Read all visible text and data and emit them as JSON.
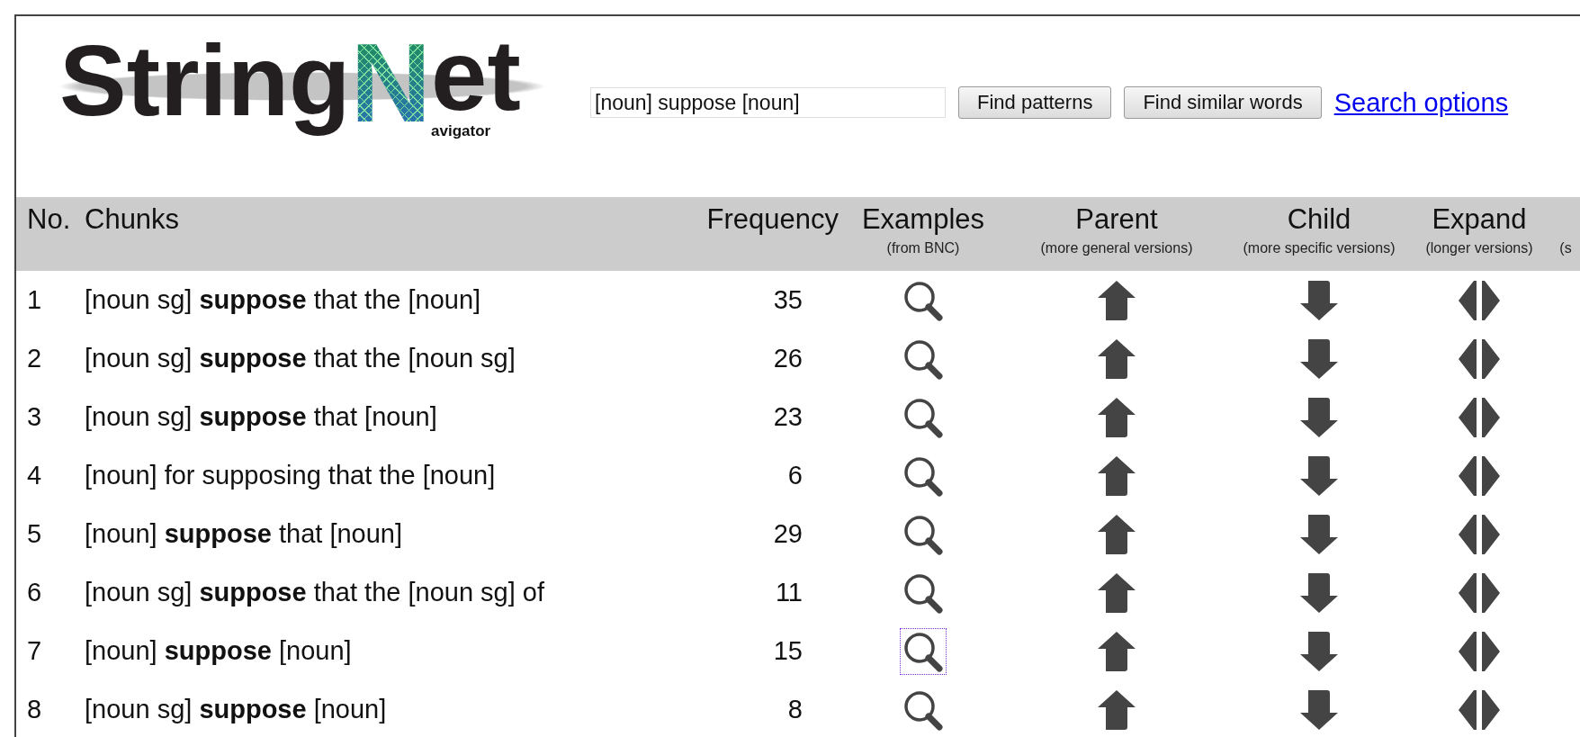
{
  "logo": {
    "word_start": "String",
    "big_letter": "N",
    "word_end": "et",
    "subtitle": "avigator"
  },
  "search": {
    "value": "[noun] suppose [noun]"
  },
  "buttons": [
    "Find patterns",
    "Find similar words"
  ],
  "search_options_link": "Search options",
  "table": {
    "columns": [
      {
        "kind": "number",
        "title": "No."
      },
      {
        "kind": "chunk",
        "title": "Chunks"
      },
      {
        "kind": "frequency",
        "title": "Frequency"
      },
      {
        "kind": "examples",
        "title": "Examples",
        "note": "(from BNC)"
      },
      {
        "kind": "parent",
        "title": "Parent",
        "note": "(more general versions)"
      },
      {
        "kind": "child",
        "title": "Child",
        "note": "(more specific versions)"
      },
      {
        "kind": "expand",
        "title": "Expand",
        "note": "(longer versions)"
      },
      {
        "kind": "cut",
        "note": "(s"
      }
    ],
    "rows": [
      {
        "number": "1",
        "chunk": "[noun sg] **suppose** that the [noun]",
        "frequency": "35",
        "focused": false
      },
      {
        "number": "2",
        "chunk": "[noun sg] **suppose** that the [noun sg]",
        "frequency": "26",
        "focused": false
      },
      {
        "number": "3",
        "chunk": "[noun sg] **suppose** that [noun]",
        "frequency": "23",
        "focused": false
      },
      {
        "number": "4",
        "chunk": "[noun] for supposing that the [noun]",
        "frequency": "6",
        "focused": false
      },
      {
        "number": "5",
        "chunk": "[noun] **suppose** that [noun]",
        "frequency": "29",
        "focused": false
      },
      {
        "number": "6",
        "chunk": "[noun sg] **suppose** that the [noun sg] of",
        "frequency": "11",
        "focused": false
      },
      {
        "number": "7",
        "chunk": "[noun] **suppose** [noun]",
        "frequency": "15",
        "focused": true
      },
      {
        "number": "8",
        "chunk": "[noun sg] **suppose** [noun]",
        "frequency": "8",
        "focused": false
      }
    ]
  }
}
